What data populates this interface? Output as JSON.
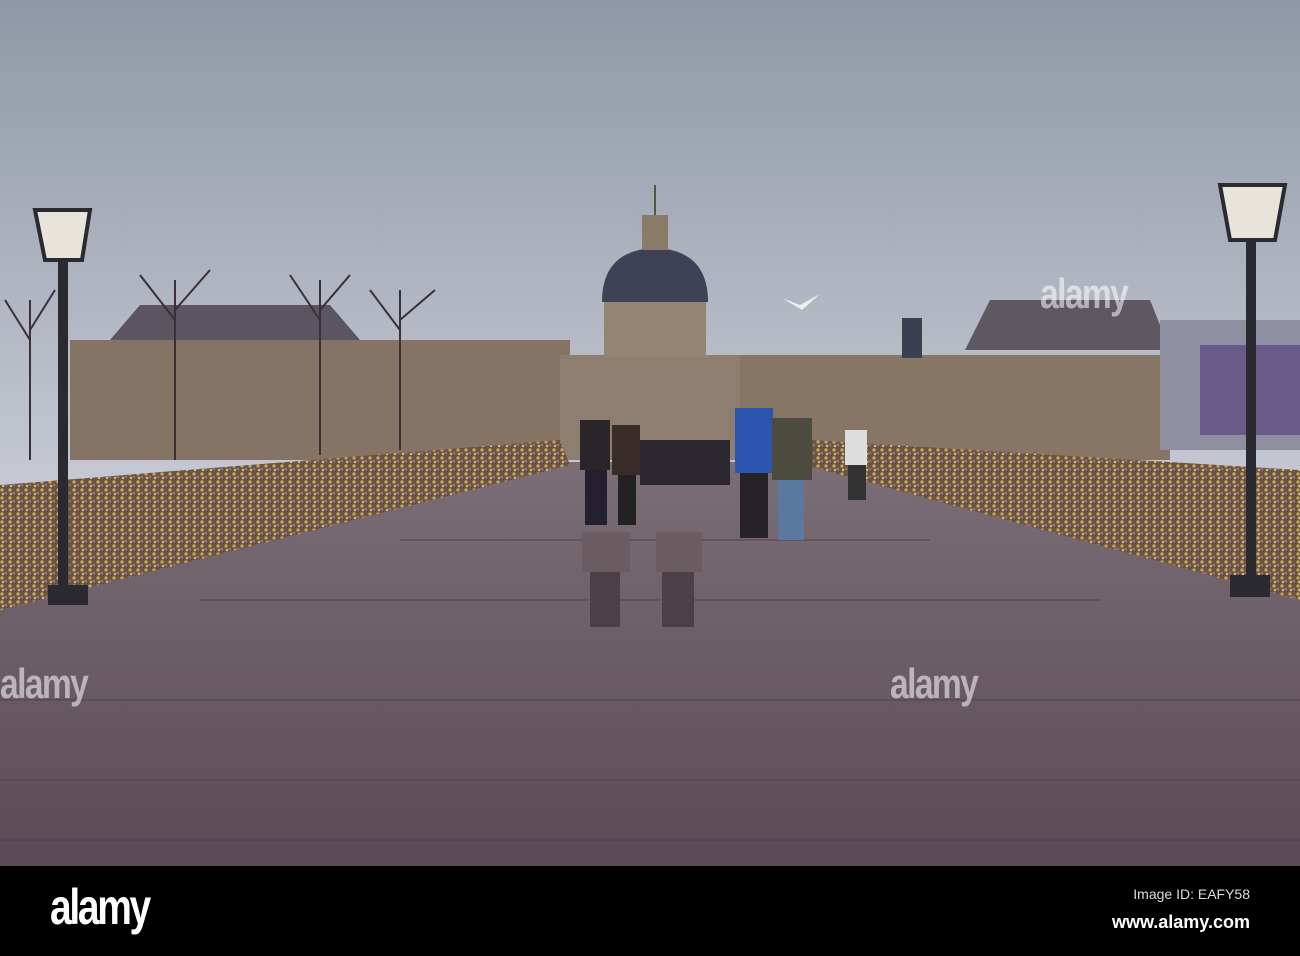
{
  "watermark": {
    "text": "alamy"
  },
  "footer": {
    "logo": "alamy",
    "image_id": "Image ID: EAFY58",
    "website": "www.alamy.com"
  },
  "colors": {
    "sky_top": "#8e97a4",
    "sky_bottom": "#d6d6dc",
    "deck": "#6b5c66",
    "footer": "#000000"
  }
}
